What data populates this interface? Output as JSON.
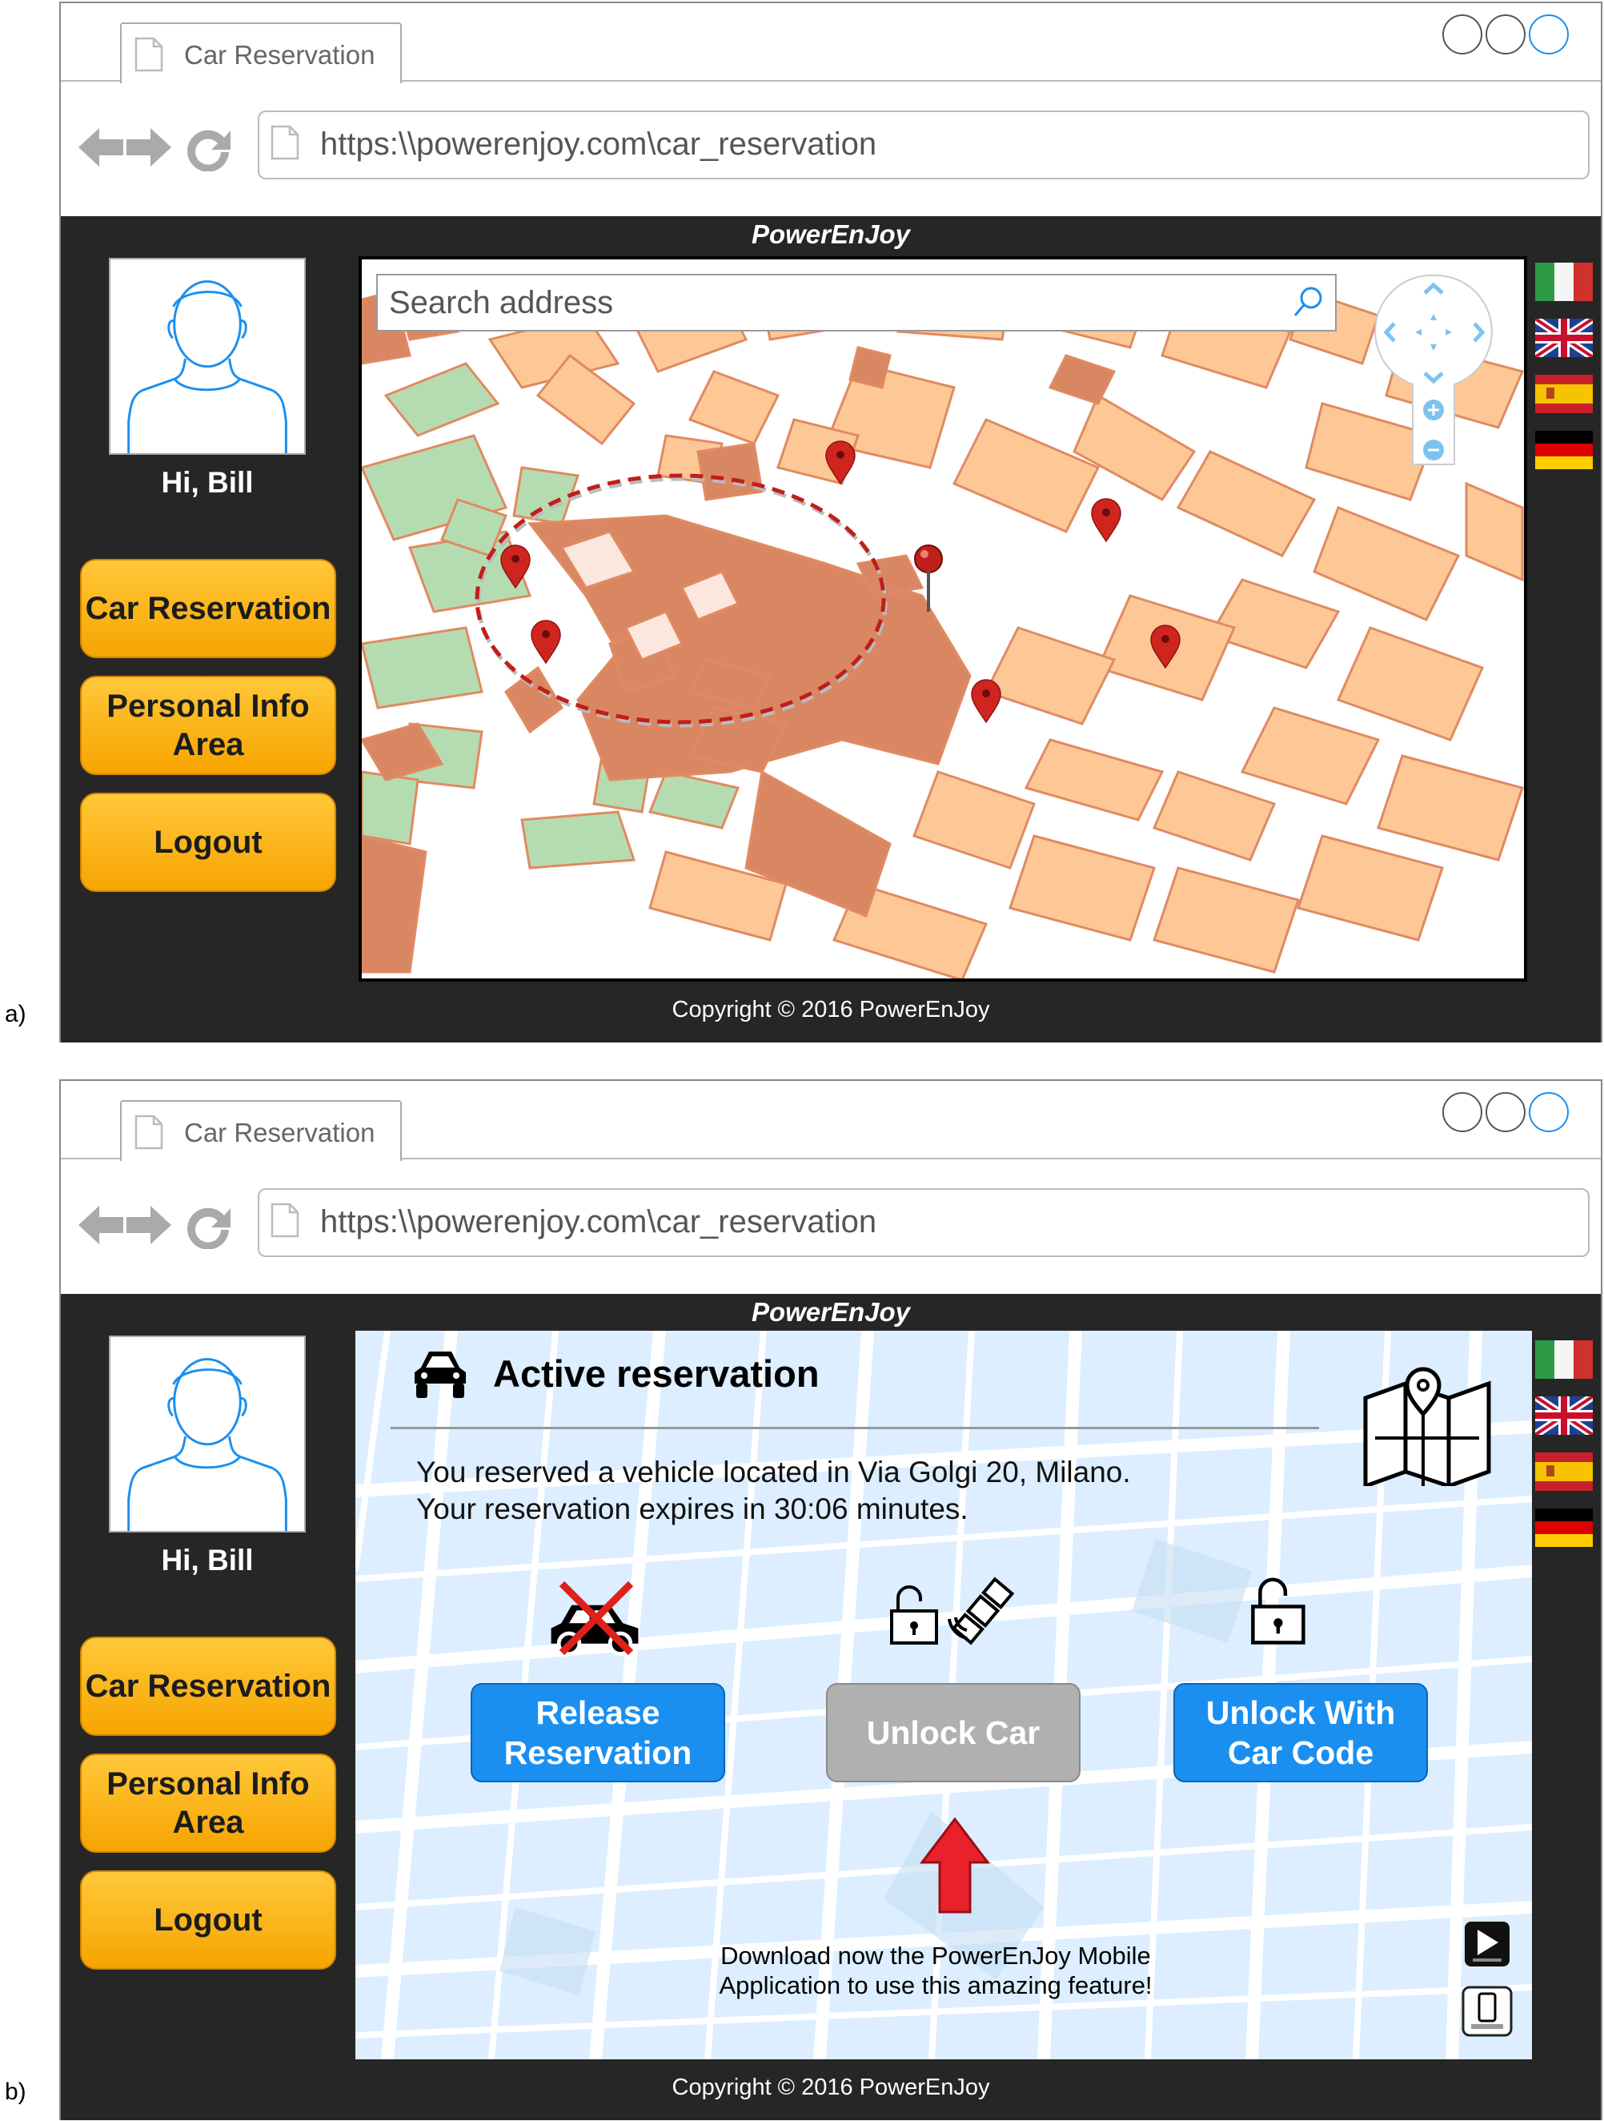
{
  "panels": [
    {
      "label": "a)",
      "tab_title": "Car Reservation",
      "url": "https:\\\\powerenjoy.com\\car_reservation",
      "brand": "PowerEnJoy",
      "greeting": "Hi, Bill",
      "menu": [
        "Car Reservation",
        "Personal Info Area",
        "Logout"
      ],
      "search_placeholder": "Search address",
      "flags": [
        "italy-flag",
        "uk-flag",
        "spain-flag",
        "germany-flag"
      ],
      "copyright": "Copyright © 2016 PowerEnJoy"
    },
    {
      "label": "b)",
      "tab_title": "Car Reservation",
      "url": "https:\\\\powerenjoy.com\\car_reservation",
      "brand": "PowerEnJoy",
      "greeting": "Hi, Bill",
      "menu": [
        "Car Reservation",
        "Personal Info Area",
        "Logout"
      ],
      "reservation": {
        "title": "Active reservation",
        "line1": "You reserved a vehicle located in Via Golgi 20, Milano.",
        "line2": "Your reservation expires in 30:06 minutes.",
        "buttons": [
          {
            "label": "Release Reservation",
            "state": "enabled"
          },
          {
            "label": "Unlock Car",
            "state": "disabled"
          },
          {
            "label": "Unlock With Car Code",
            "state": "enabled"
          }
        ],
        "download_text": "Download now the PowerEnJoy Mobile Application to use this amazing feature!"
      },
      "flags": [
        "italy-flag",
        "uk-flag",
        "spain-flag",
        "germany-flag"
      ],
      "copyright": "Copyright © 2016 PowerEnJoy"
    }
  ],
  "colors": {
    "accent_orange": "#f7a400",
    "button_blue": "#1a8ff0",
    "disabled_grey": "#b0b0b0",
    "app_bg": "#262626",
    "map_block": "#fdc896",
    "map_park": "#b5dcb0",
    "map_square": "#d98763",
    "pin_red": "#d0251f"
  }
}
